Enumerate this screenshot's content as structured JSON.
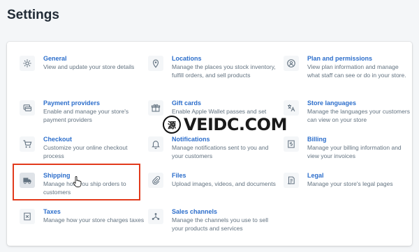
{
  "page": {
    "title": "Settings"
  },
  "items": {
    "general": {
      "title": "General",
      "desc": "View and update your store details",
      "icon": "gear-icon"
    },
    "locations": {
      "title": "Locations",
      "desc": "Manage the places you stock inventory, fulfill orders, and sell products",
      "icon": "map-pin-icon"
    },
    "plan": {
      "title": "Plan and permissions",
      "desc": "View plan information and manage what staff can see or do in your store.",
      "icon": "account-icon"
    },
    "payment": {
      "title": "Payment providers",
      "desc": "Enable and manage your store's payment providers",
      "icon": "payment-icon"
    },
    "gift": {
      "title": "Gift cards",
      "desc": "Enable Apple Wallet passes and set",
      "icon": "gift-icon"
    },
    "languages": {
      "title": "Store languages",
      "desc": "Manage the languages your customers can view on your store",
      "icon": "translate-icon"
    },
    "checkout": {
      "title": "Checkout",
      "desc": "Customize your online checkout process",
      "icon": "cart-icon"
    },
    "notifications": {
      "title": "Notifications",
      "desc": "Manage notifications sent to you and your customers",
      "icon": "bell-icon"
    },
    "billing": {
      "title": "Billing",
      "desc": "Manage your billing information and view your invoices",
      "icon": "billing-icon"
    },
    "shipping": {
      "title": "Shipping",
      "desc": "Manage how you ship orders to customers",
      "icon": "truck-icon"
    },
    "files": {
      "title": "Files",
      "desc": "Upload images, videos, and documents",
      "icon": "paperclip-icon"
    },
    "legal": {
      "title": "Legal",
      "desc": "Manage your store's legal pages",
      "icon": "document-icon"
    },
    "taxes": {
      "title": "Taxes",
      "desc": "Manage how your store charges taxes",
      "icon": "tax-icon"
    },
    "sales": {
      "title": "Sales channels",
      "desc": "Manage the channels you use to sell your products and services",
      "icon": "channels-icon"
    }
  },
  "watermark": {
    "seal": "源",
    "text": "VEIDC.COM"
  },
  "colors": {
    "link": "#2c6ecb",
    "highlight": "#e23a1c",
    "muted": "#637381"
  }
}
